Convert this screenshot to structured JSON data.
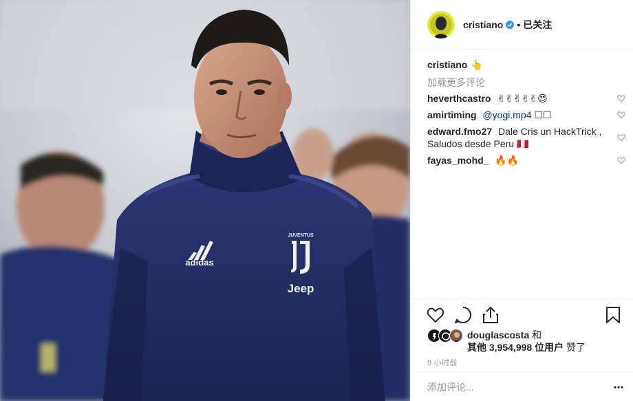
{
  "header": {
    "username": "cristiano",
    "separator": "•",
    "follow_state": "已关注"
  },
  "caption": {
    "username": "cristiano",
    "text": "👆"
  },
  "load_more": "加载更多评论",
  "comments": [
    {
      "user": "heverthcastro",
      "text": "✌✌✌✌✌😍"
    },
    {
      "user": "amirtiming",
      "mention": "@yogi.mp4",
      "text": "☐☐"
    },
    {
      "user": "edward.fmo27",
      "text": "Dale Cris un HackTrick , Saludos desde Peru 🇵🇪"
    },
    {
      "user": "fayas_mohd_",
      "text": "🔥🔥"
    }
  ],
  "likes": {
    "first_user": "douglascosta",
    "and": "和",
    "others_prefix": "其他",
    "count": "3,954,998",
    "others_suffix": "位用户",
    "liked": "赞了"
  },
  "time": "9 小时前",
  "add_comment": {
    "placeholder": "添加评论..."
  },
  "photo": {
    "chest_logo_text": "adidas",
    "club_text": "JUVENTUS",
    "sponsor_text": "Jeep"
  },
  "colors": {
    "verified": "#3897f0",
    "link": "#003569",
    "muted": "#999999",
    "border": "#efefef",
    "kit_navy": "#1f2a5e"
  }
}
